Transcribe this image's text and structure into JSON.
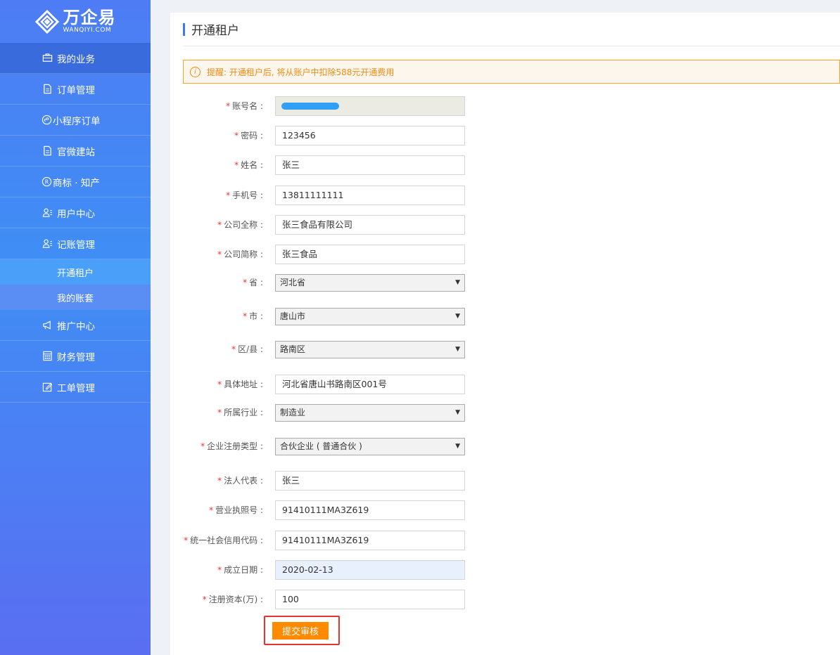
{
  "brand": {
    "name": "万企易",
    "domain": "WANQIYI.COM"
  },
  "sidebar": {
    "items": [
      {
        "label": "我的业务",
        "icon": "briefcase-icon"
      },
      {
        "label": "订单管理",
        "icon": "document-icon"
      },
      {
        "label": "小程序订单",
        "icon": "mini-program-icon"
      },
      {
        "label": "官微建站",
        "icon": "document-icon"
      },
      {
        "label": "商标 · 知产",
        "icon": "registered-icon"
      },
      {
        "label": "用户中心",
        "icon": "user-list-icon"
      },
      {
        "label": "记账管理",
        "icon": "user-list-icon"
      }
    ],
    "sub_items": [
      {
        "label": "开通租户"
      },
      {
        "label": "我的账套"
      }
    ],
    "items_after": [
      {
        "label": "推广中心",
        "icon": "megaphone-icon"
      },
      {
        "label": "财务管理",
        "icon": "calculator-icon"
      },
      {
        "label": "工单管理",
        "icon": "edit-icon"
      }
    ]
  },
  "page": {
    "title": "开通租户",
    "notice": "提醒: 开通租户后, 将从账户中扣除588元开通费用",
    "required_mark": "*"
  },
  "form": {
    "account": {
      "label": "账号名 :"
    },
    "password": {
      "label": "密码 :",
      "value": "123456"
    },
    "name": {
      "label": "姓名 :",
      "value": "张三"
    },
    "phone": {
      "label": "手机号 :",
      "value": "13811111111"
    },
    "company_full": {
      "label": "公司全称 :",
      "value": "张三食品有限公司"
    },
    "company_short": {
      "label": "公司简称 :",
      "value": "张三食品"
    },
    "province": {
      "label": "省 :",
      "value": "河北省"
    },
    "city": {
      "label": "市 :",
      "value": "唐山市"
    },
    "district": {
      "label": "区/县 :",
      "value": "路南区"
    },
    "address": {
      "label": "具体地址 :",
      "value": "河北省唐山书路南区001号"
    },
    "industry": {
      "label": "所属行业 :",
      "value": "制造业"
    },
    "reg_type": {
      "label": "企业注册类型 :",
      "value": "合伙企业 ( 普通合伙 )"
    },
    "legal_rep": {
      "label": "法人代表 :",
      "value": "张三"
    },
    "license_no": {
      "label": "营业执照号 :",
      "value": "91410111MA3Z619"
    },
    "credit_code": {
      "label": "统一社会信用代码 :",
      "value": "91410111MA3Z619"
    },
    "est_date": {
      "label": "成立日期 :",
      "value": "2020-02-13"
    },
    "capital": {
      "label": "注册资本(万) :",
      "value": "100"
    },
    "submit_label": "提交审核"
  }
}
